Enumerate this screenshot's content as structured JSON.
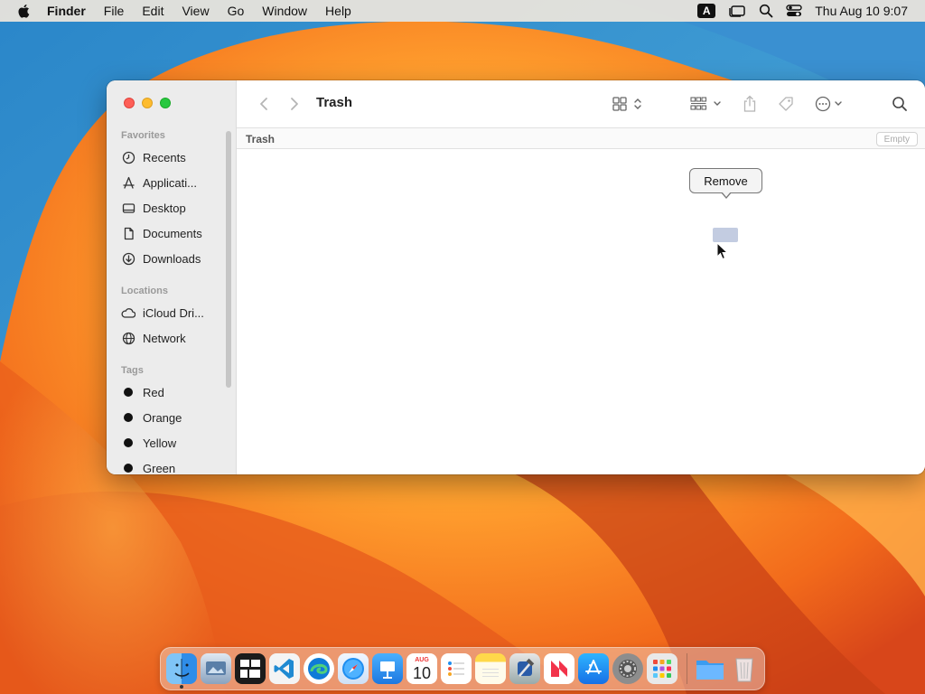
{
  "menubar": {
    "apple_icon": "apple-logo",
    "app_name": "Finder",
    "items": [
      "File",
      "Edit",
      "View",
      "Go",
      "Window",
      "Help"
    ],
    "input_source": "A",
    "clock": "Thu Aug 10  9:07"
  },
  "window": {
    "title": "Trash",
    "sidebar": {
      "favorites_heading": "Favorites",
      "favorites": [
        {
          "label": "Recents",
          "icon": "clock-icon"
        },
        {
          "label": "Applicati...",
          "icon": "applications-icon"
        },
        {
          "label": "Desktop",
          "icon": "desktop-icon"
        },
        {
          "label": "Documents",
          "icon": "document-icon"
        },
        {
          "label": "Downloads",
          "icon": "download-icon"
        }
      ],
      "locations_heading": "Locations",
      "locations": [
        {
          "label": "iCloud Dri...",
          "icon": "cloud-icon"
        },
        {
          "label": "Network",
          "icon": "globe-icon"
        }
      ],
      "tags_heading": "Tags",
      "tags": [
        {
          "label": "Red"
        },
        {
          "label": "Orange"
        },
        {
          "label": "Yellow"
        },
        {
          "label": "Green"
        }
      ]
    },
    "pathbar": {
      "title": "Trash",
      "empty_button": "Empty"
    },
    "tooltip": "Remove"
  },
  "dock": {
    "apps": [
      "Finder",
      "Preview",
      "Mission Control",
      "Visual Studio Code",
      "Microsoft Edge",
      "Safari",
      "Keynote",
      "Calendar",
      "Reminders",
      "Notes",
      "Xcode",
      "News",
      "App Store",
      "System Settings",
      "Launchpad"
    ],
    "calendar_month": "AUG",
    "calendar_day": "10",
    "extras": [
      "Downloads Folder",
      "Trash"
    ]
  }
}
